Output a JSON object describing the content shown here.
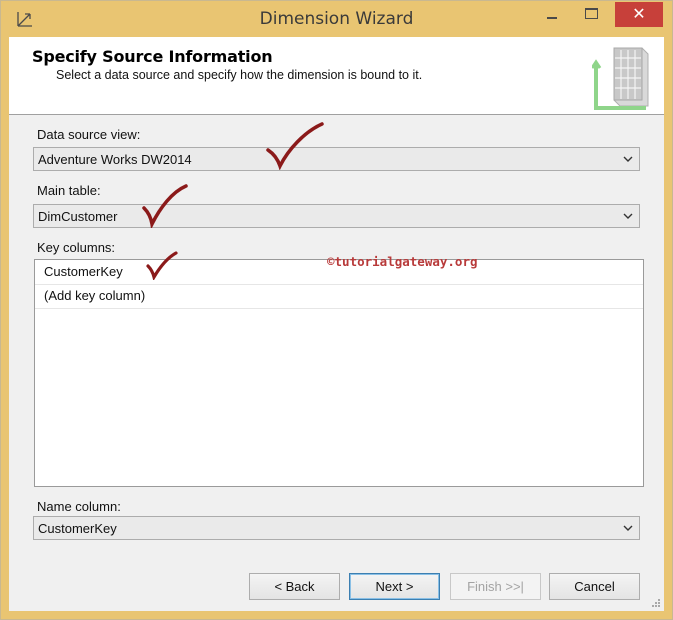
{
  "window": {
    "title": "Dimension Wizard",
    "close_glyph": "✕"
  },
  "header": {
    "title": "Specify Source Information",
    "subtitle": "Select a data source and specify how the dimension is bound to it."
  },
  "data_source_view": {
    "label": "Data source view:",
    "value": "Adventure Works DW2014"
  },
  "main_table": {
    "label": "Main table:",
    "value": "DimCustomer"
  },
  "key_columns": {
    "label": "Key columns:",
    "rows": [
      "CustomerKey",
      "(Add key column)"
    ]
  },
  "name_column": {
    "label": "Name column:",
    "value": "CustomerKey"
  },
  "watermark": "©tutorialgateway.org",
  "buttons": {
    "back": "< Back",
    "next": "Next >",
    "finish": "Finish >>|",
    "cancel": "Cancel"
  },
  "colors": {
    "titlebar": "#e9c572",
    "close": "#c7403a",
    "annotation": "#8b1a1a"
  },
  "icons": [
    "app-icon",
    "minimize-icon",
    "maximize-icon",
    "close-icon",
    "dimension-cube-icon",
    "chevron-down-icon",
    "checkmark-annotation",
    "size-grip-icon"
  ]
}
